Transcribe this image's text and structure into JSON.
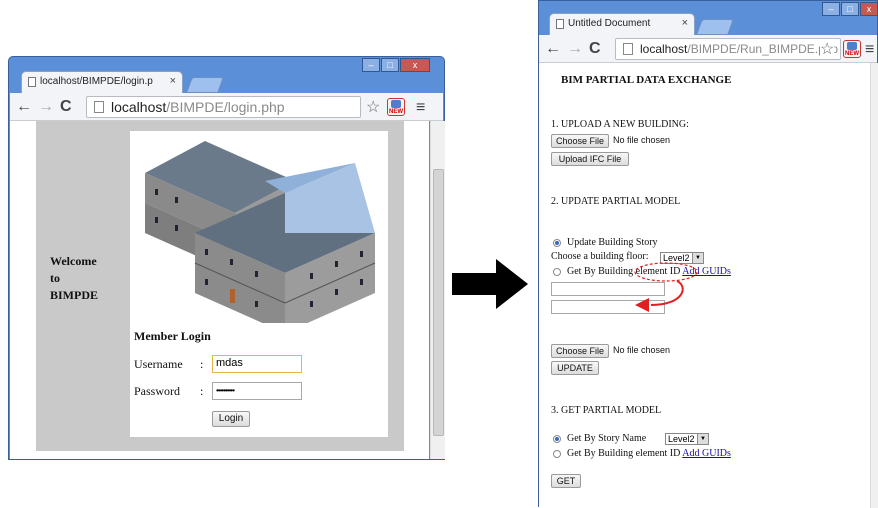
{
  "left_window": {
    "tab_title": "localhost/BIMPDE/login.p",
    "url_host": "localhost",
    "url_path": "/BIMPDE/login.php",
    "welcome_lines": [
      "Welcome",
      "to",
      "BIMPDE"
    ],
    "member_login": "Member Login",
    "username_label": "Username",
    "username_value": "mdas",
    "password_label": "Password",
    "password_value": "••••••••••",
    "separator": ":",
    "login_button": "Login"
  },
  "right_window": {
    "tab_title": "Untitled Document",
    "url_host": "localhost",
    "url_path": "/BIMPDE/Run_BIMPDE.php",
    "heading": "BIM PARTIAL DATA EXCHANGE",
    "section1": {
      "title": "1. UPLOAD A NEW BUILDING:",
      "choose_file": "Choose File",
      "no_file": "No file chosen",
      "upload_button": "Upload IFC File"
    },
    "section2": {
      "title": "2. UPDATE PARTIAL MODEL",
      "radio_story": "Update Building Story",
      "floor_label": "Choose a building floor:",
      "floor_value": "Level2",
      "radio_element_prefix": "Get By Building",
      "radio_element_circled": "element ID",
      "add_guids": "Add GUIDs",
      "choose_file": "Choose File",
      "no_file": "No file chosen",
      "update_button": "UPDATE"
    },
    "section3": {
      "title": "3. GET PARTIAL MODEL",
      "radio_story": "Get By Story Name",
      "story_value": "Level2",
      "radio_element": "Get By Building element ID",
      "add_guids": "Add GUIDs",
      "get_button": "GET"
    }
  },
  "window_controls": {
    "minimize": "–",
    "maximize": "□",
    "close": "x"
  },
  "colors": {
    "chrome_frame": "#5b8fd8",
    "annotation_red": "#e02020",
    "link": "#1a0dab"
  }
}
